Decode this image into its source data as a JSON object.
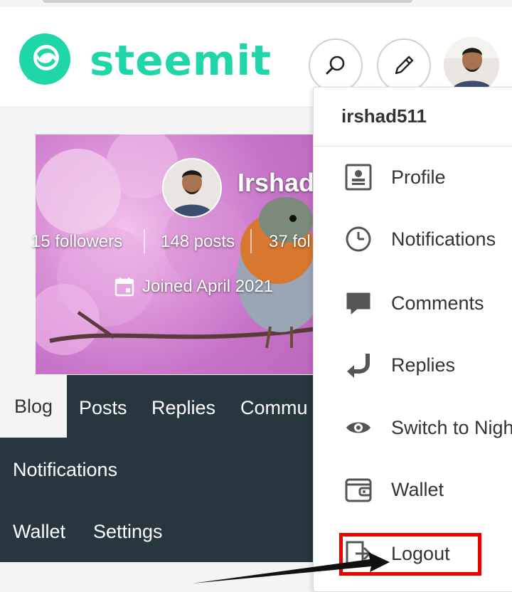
{
  "app": {
    "brand": "steemit",
    "accent_color": "#1fd6a8",
    "nav_bg": "#283640"
  },
  "header": {
    "search_icon": "search-icon",
    "edit_icon": "pencil-icon",
    "avatar": "user-avatar"
  },
  "profile": {
    "name": "Irshad",
    "followers": "15 followers",
    "posts": "148 posts",
    "following": "37 fol",
    "joined": "Joined April 2021"
  },
  "tabs": {
    "blog": "Blog",
    "posts": "Posts",
    "replies": "Replies",
    "communities": "Commu",
    "notifications": "Notifications",
    "wallet": "Wallet",
    "settings": "Settings"
  },
  "dropdown": {
    "username": "irshad511",
    "items": [
      {
        "label": "Profile",
        "icon": "profile-card-icon"
      },
      {
        "label": "Notifications",
        "icon": "clock-icon"
      },
      {
        "label": "Comments",
        "icon": "speech-bubble-icon"
      },
      {
        "label": "Replies",
        "icon": "reply-arrow-icon"
      },
      {
        "label": "Switch to Nigh",
        "icon": "eye-icon"
      },
      {
        "label": "Wallet",
        "icon": "wallet-icon"
      },
      {
        "label": "Logout",
        "icon": "logout-icon"
      }
    ]
  },
  "annotation": {
    "highlight_color": "#ee0000"
  }
}
